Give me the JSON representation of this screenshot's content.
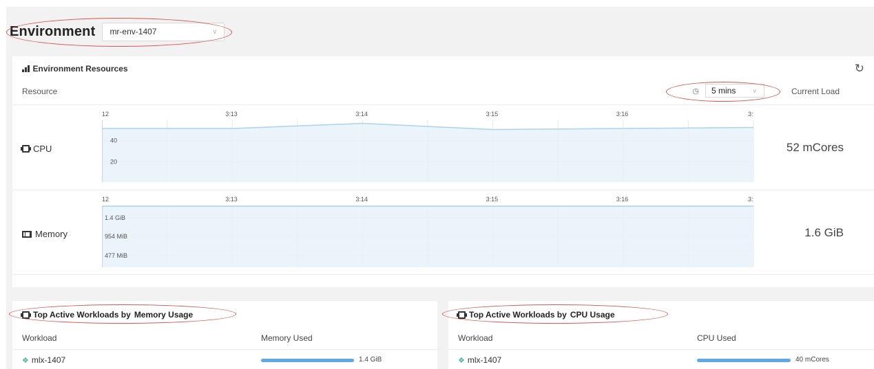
{
  "environment": {
    "title": "Environment",
    "selected": "mr-env-1407"
  },
  "resources": {
    "title": "Environment Resources",
    "col_resource": "Resource",
    "col_current_load": "Current Load",
    "time_range": "5 mins",
    "time_labels": [
      "12",
      "3:13",
      "3:14",
      "3:15",
      "3:16",
      "3:"
    ],
    "cpu": {
      "label": "CPU",
      "value": "52 mCores",
      "y_ticks": [
        "40",
        "20"
      ]
    },
    "memory": {
      "label": "Memory",
      "value": "1.6 GiB",
      "y_ticks": [
        "1.4 GiB",
        "954 MiB",
        "477 MiB"
      ]
    }
  },
  "chart_data": [
    {
      "type": "area",
      "x": [
        "12",
        "3:13",
        "3:14",
        "3:15",
        "3:16",
        "3:"
      ],
      "y_ticks": [
        "40",
        "20"
      ],
      "values": [
        52,
        52,
        57,
        51,
        52,
        53
      ],
      "ylim": [
        0,
        60
      ],
      "color": "#a9d3f0"
    },
    {
      "type": "area",
      "x": [
        "12",
        "3:13",
        "3:14",
        "3:15",
        "3:16",
        "3:"
      ],
      "y_ticks": [
        "1.4 GiB",
        "954 MiB",
        "477 MiB"
      ],
      "values": [
        1.6,
        1.6,
        1.6,
        1.6,
        1.6,
        1.6
      ],
      "ylim": [
        0,
        1.6
      ],
      "color": "#a9d3f0"
    }
  ],
  "workloads_memory": {
    "title_prefix": "Top Active Workloads by ",
    "title_strong": "Memory Usage",
    "col_workload": "Workload",
    "col_used": "Memory Used",
    "rows": [
      {
        "name": "mlx-1407",
        "value": "1.4 GiB",
        "fraction": 1.0
      }
    ]
  },
  "workloads_cpu": {
    "title_prefix": "Top Active Workloads by ",
    "title_strong": "CPU Usage",
    "col_workload": "Workload",
    "col_used": "CPU Used",
    "rows": [
      {
        "name": "mlx-1407",
        "value": "40 mCores",
        "fraction": 1.0
      }
    ]
  },
  "colors": {
    "accent_bar": "#5ca9ea",
    "annotation": "#d9534f",
    "chart_fill": "#e8f1fa",
    "chart_line": "#a9d3f0"
  }
}
